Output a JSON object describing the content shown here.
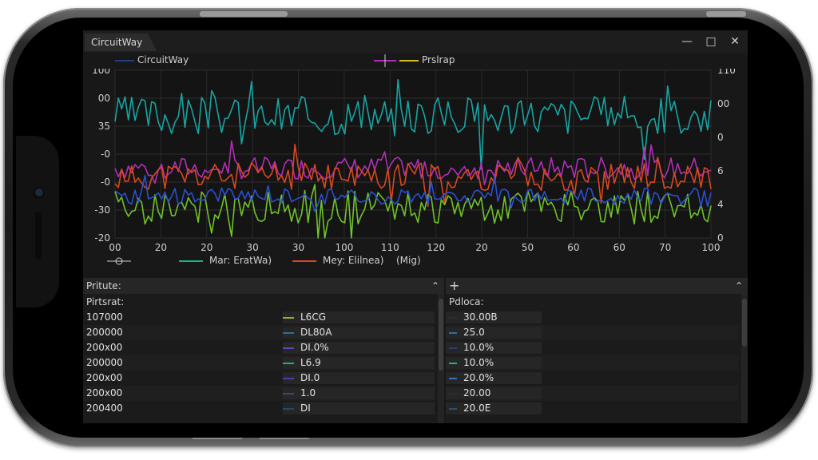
{
  "window": {
    "tab_title": "CircuitWay",
    "minimize_icon": "minimize-icon",
    "maximize_icon": "maximize-icon",
    "close_icon": "close-icon"
  },
  "chart_data": {
    "type": "line",
    "legend_top": [
      "CircuitWay",
      "Prslrap"
    ],
    "left_ticks": [
      "100",
      "00",
      "35",
      "-0",
      "-0",
      "-30",
      "-20"
    ],
    "right_ticks": [
      "110",
      "00",
      "0",
      "6",
      "4",
      "0"
    ],
    "x_ticks": [
      "00",
      "20",
      "20",
      "30",
      "30",
      "100",
      "110",
      "120",
      "20",
      "50",
      "60",
      "60",
      "70",
      "100"
    ],
    "series": [
      {
        "name": "CircuitWay",
        "color": "#17a5a3",
        "baseline": 68,
        "amp": 14,
        "seed": 3
      },
      {
        "name": "Prslrap",
        "color": "#b12fb6",
        "baseline": 30,
        "amp": 8,
        "seed": 7
      },
      {
        "color": "#d8481f",
        "baseline": 24,
        "amp": 10,
        "seed": 11
      },
      {
        "color": "#6fc22a",
        "baseline": 2,
        "amp": 12,
        "seed": 19
      },
      {
        "color": "#2c4fd0",
        "baseline": 10,
        "amp": 6,
        "seed": 23
      }
    ],
    "ylim": [
      -20,
      100
    ],
    "grid": true
  },
  "bottom_legend": {
    "item1": "Mar:  EratWa)",
    "item2": "Mey:  Elilnea)",
    "item3": "(Mig)"
  },
  "left_panel": {
    "header": "Pritute:",
    "subheader": "Pirtsrat:",
    "rows": [
      {
        "value": "107000",
        "label": "L6CG",
        "color": "#a2a63a"
      },
      {
        "value": "200000",
        "label": "DL80A",
        "color": "#2a6fa0"
      },
      {
        "value": "200x00",
        "label": "DI.0%",
        "color": "#6a3fc4"
      },
      {
        "value": "200000",
        "label": "L6.9",
        "color": "#1fb089"
      },
      {
        "value": "200x00",
        "label": "DI.0",
        "color": "#4c3fb0"
      },
      {
        "value": "200x00",
        "label": "1.0",
        "color": "#2f4d80"
      },
      {
        "value": "200400",
        "label": "DI",
        "color": "#27466a"
      }
    ]
  },
  "right_panel": {
    "header_icon": "plus-icon",
    "subheader": "Pdloca:",
    "rows": [
      {
        "value": "30.00B",
        "color": "#2e2e2e"
      },
      {
        "value": "25.0",
        "color": "#2f6fa8"
      },
      {
        "value": "10.0%",
        "color": "#2a3f70"
      },
      {
        "value": "10.0%",
        "color": "#1fb089"
      },
      {
        "value": "20.0%",
        "color": "#2c75c2"
      },
      {
        "value": "20.00",
        "color": "#2e2e2e"
      },
      {
        "value": "20.0E",
        "color": "#2d4d70"
      }
    ]
  }
}
